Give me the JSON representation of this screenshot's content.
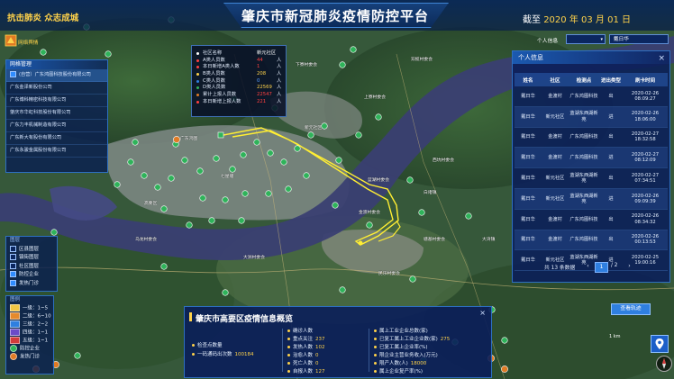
{
  "header": {
    "title": "肇庆市新冠肺炎疫情防控平台",
    "slogan": "抗击肺炎 众志成城",
    "date_prefix": "截至",
    "date_value": "2020 年 03 月 01 日"
  },
  "logo": {
    "text": "网络舆情",
    "icon": "logo-mark"
  },
  "company_list": {
    "heading": "网格管理",
    "items": [
      {
        "label": "(自营）广东鸿图科技股份有限公司",
        "selected": true
      },
      {
        "label": "广东金泽新股份公司",
        "selected": false
      },
      {
        "label": "广东博科精密科技有限公司",
        "selected": false
      },
      {
        "label": "肇庆市华虹科技股份有限公司",
        "selected": false
      },
      {
        "label": "广东力丰机械制造有限公司",
        "selected": false
      },
      {
        "label": "广东新大有股份有限公司",
        "selected": false
      },
      {
        "label": "广东永骏金属股份有限公司",
        "selected": false
      }
    ]
  },
  "layers": {
    "heading": "图层",
    "items": [
      {
        "label": "区县图层",
        "checked": false
      },
      {
        "label": "镇街图层",
        "checked": false
      },
      {
        "label": "社区图层",
        "checked": false
      },
      {
        "label": "防控企业",
        "checked": true
      },
      {
        "label": "发热门诊",
        "checked": true
      }
    ]
  },
  "legend": {
    "heading": "图例",
    "items": [
      {
        "label": "一级：1~5",
        "color": "#f2c744"
      },
      {
        "label": "二级：6~10",
        "color": "#e58a2c"
      },
      {
        "label": "三级：2~2",
        "color": "#2f7fe0"
      },
      {
        "label": "四级：1~1",
        "color": "#6a4bc8"
      },
      {
        "label": "五级：1~1",
        "color": "#d23b3b"
      },
      {
        "label": "防控企业",
        "color": "#2fb35a"
      },
      {
        "label": "发热门诊",
        "color": "#e07b25"
      }
    ]
  },
  "popup": {
    "rows": [
      {
        "label": "社区名称",
        "value": "新元社区",
        "unit": "",
        "color": "#ffffff"
      },
      {
        "label": "A类人员数",
        "value": "44",
        "unit": "人",
        "color": "#ff4040"
      },
      {
        "label": "本日新增A类人数",
        "value": "1",
        "unit": "人",
        "color": "#ff4040"
      },
      {
        "label": "B类人员数",
        "value": "208",
        "unit": "人",
        "color": "#ffd24a"
      },
      {
        "label": "C类人员数",
        "value": "0",
        "unit": "人",
        "color": "#2f7fe0"
      },
      {
        "label": "D类人员数",
        "value": "22569",
        "unit": "人",
        "color": "#2fb35a"
      },
      {
        "label": "累计上报人员数",
        "value": "22547",
        "unit": "人",
        "color": "#e07b25"
      },
      {
        "label": "本日新增上报人数",
        "value": "221",
        "unit": "人",
        "color": "#ff4040"
      }
    ]
  },
  "person_search": {
    "type_label": "个人信息",
    "type_value": "",
    "query": "戴日华"
  },
  "person_panel": {
    "heading": "个人信息",
    "close": "×",
    "columns": [
      "姓名",
      "社区",
      "检测点",
      "进出类型",
      "刷卡时间"
    ],
    "rows": [
      {
        "name": "戴日华",
        "community": "金渡村",
        "checkpoint": "广东鸿图科技",
        "direction": "出",
        "time": "2020-02-26 08:09:27"
      },
      {
        "name": "戴日华",
        "community": "新元社区",
        "checkpoint": "蓝湖东西湖新苑",
        "direction": "进",
        "time": "2020-02-26 18:06:00"
      },
      {
        "name": "戴日华",
        "community": "金渡村",
        "checkpoint": "广东鸿图科技",
        "direction": "出",
        "time": "2020-02-27 18:32:58"
      },
      {
        "name": "戴日华",
        "community": "金渡村",
        "checkpoint": "广东鸿图科技",
        "direction": "进",
        "time": "2020-02-27 08:12:09"
      },
      {
        "name": "戴日华",
        "community": "新元社区",
        "checkpoint": "蓝湖东西湖新苑",
        "direction": "出",
        "time": "2020-02-27 07:34:51"
      },
      {
        "name": "戴日华",
        "community": "新元社区",
        "checkpoint": "蓝湖东西湖新苑",
        "direction": "进",
        "time": "2020-02-26 09:09:39"
      },
      {
        "name": "戴日华",
        "community": "金渡村",
        "checkpoint": "广东鸿图科技",
        "direction": "出",
        "time": "2020-02-26 08:34:32"
      },
      {
        "name": "戴日华",
        "community": "金渡村",
        "checkpoint": "广东鸿图科技",
        "direction": "出",
        "time": "2020-02-26 00:13:53"
      },
      {
        "name": "戴日华",
        "community": "新元社区",
        "checkpoint": "蓝湖东西湖新苑",
        "direction": "进",
        "time": "2020-02-25 19:00:16"
      }
    ],
    "pager": {
      "summary": "共 13 条数据",
      "prev": "‹",
      "current": "1",
      "total": "/ 2",
      "next": "›"
    }
  },
  "track_button": "查看轨迹",
  "overview": {
    "title": "肇庆市高要区疫情信息概览",
    "col1": [
      {
        "label": "检查点数量",
        "value": ""
      },
      {
        "label": "一码通码出次数",
        "value": "100184"
      }
    ],
    "col2": [
      {
        "label": "确诊人数",
        "value": ""
      },
      {
        "label": "重点关注",
        "value": "237"
      },
      {
        "label": "发热人数",
        "value": "102"
      },
      {
        "label": "治愈人数",
        "value": "0"
      },
      {
        "label": "死亡人数",
        "value": "0"
      },
      {
        "label": "自报人数",
        "value": "127"
      }
    ],
    "col3": [
      {
        "label": "属上工业企业总数(家)",
        "value": ""
      },
      {
        "label": "已复工属上工业企业数(家)",
        "value": "275"
      },
      {
        "label": "已复工属上企业率(%)",
        "value": ""
      },
      {
        "label": "限企业主营业务收入(万元)",
        "value": ""
      },
      {
        "label": "限产人数(人)",
        "value": "18000"
      },
      {
        "label": "属上企业复产率(%)",
        "value": ""
      }
    ]
  },
  "map_labels": [
    "下寮村委会",
    "上寮村委会",
    "双榄村委会",
    "新元社区",
    "蓝湖村委会",
    "金渡村委会",
    "西坑村委会",
    "白诸镇",
    "塘基村委会",
    "大湾镇",
    "大洲村委会",
    "乌龙村委会",
    "民乐村委会",
    "七星塘",
    "广东鸿图",
    "高要区"
  ],
  "map_widgets": {
    "scale_text": "1 km",
    "locate_icon": "locate-icon",
    "compass_icon": "compass-icon"
  }
}
